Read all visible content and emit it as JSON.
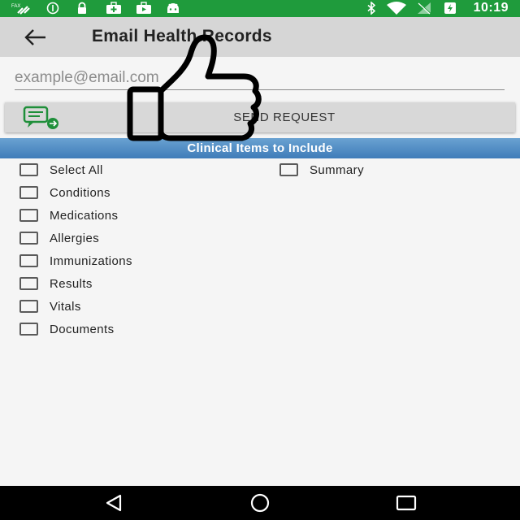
{
  "status": {
    "time": "10:19"
  },
  "toolbar": {
    "title": "Email Health Records"
  },
  "email": {
    "placeholder": "example@email.com",
    "value": ""
  },
  "send_button": {
    "label": "SEND REQUEST"
  },
  "section": {
    "title": "Clinical Items to Include"
  },
  "items": {
    "select_all": "Select All",
    "summary": "Summary",
    "conditions": "Conditions",
    "medications": "Medications",
    "allergies": "Allergies",
    "immunizations": "Immunizations",
    "results": "Results",
    "vitals": "Vitals",
    "documents": "Documents"
  }
}
